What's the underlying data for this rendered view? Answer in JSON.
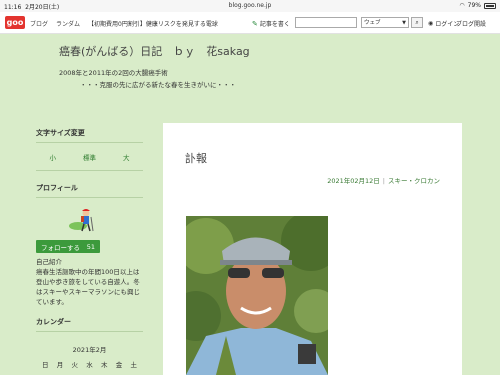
{
  "status": {
    "time": "11:16",
    "date": "2月20日(土)",
    "url": "blog.goo.ne.jp",
    "battery": "79%"
  },
  "goo": {
    "logo": "goo",
    "nav": [
      "ブログ",
      "ランダム",
      "【初期費用0円割引】健康リスクを発見する電球"
    ],
    "write": "記事を書く",
    "search_select": "ウェブ",
    "login": "ログイン",
    "blog_open": "ブログ開設"
  },
  "blog": {
    "title": "癌春(がんばる）日記　ｂｙ　花sakag",
    "desc1": "2008年と2011年の2回の大腸癌手術",
    "desc2": "・・・克服の先に広がる新たな春を生きがいに・・・"
  },
  "sidebar": {
    "fontsize_heading": "文字サイズ変更",
    "fontsize_options": [
      "小",
      "標準",
      "大"
    ],
    "profile_heading": "プロフィール",
    "follow_label": "フォローする",
    "follow_count": "51",
    "intro_lines": [
      "自己紹介",
      "癌春生活謳歌中の年間100日以上は",
      "登山や歩き旅をしている自遊人。冬",
      "はスキーやスキーマラソンにも興じ",
      "ています。"
    ],
    "calendar_heading": "カレンダー",
    "calendar_month": "2021年2月",
    "calendar_days": [
      "日",
      "月",
      "火",
      "水",
      "木",
      "金",
      "土"
    ]
  },
  "post": {
    "title": "訃報",
    "date": "2021年02月12日",
    "category": "スキー・クロカン"
  }
}
